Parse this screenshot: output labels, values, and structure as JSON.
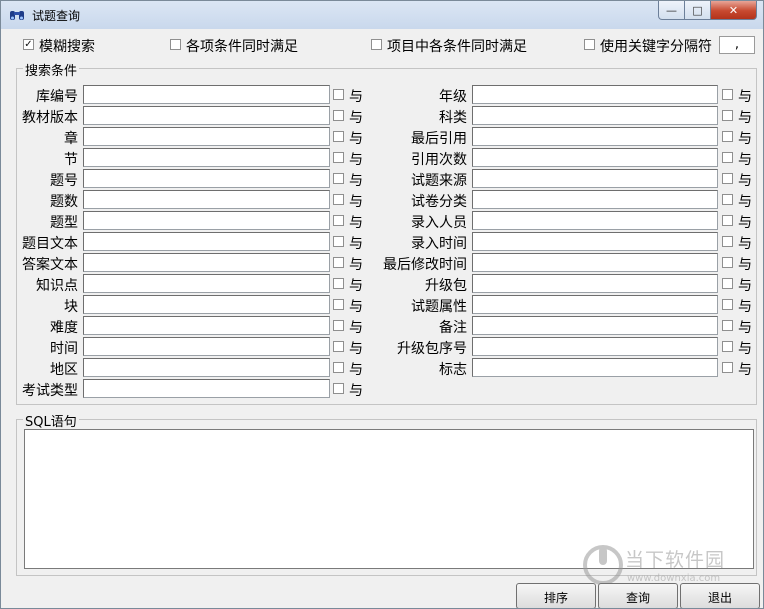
{
  "window": {
    "title": "试题查询",
    "icon": "binoculars-icon",
    "controls": {
      "minimize": "—",
      "maximize": "□",
      "close": "✕"
    }
  },
  "options": {
    "fuzzy_search": {
      "label": "模糊搜索",
      "checked": true
    },
    "all_conditions": {
      "label": "各项条件同时满足",
      "checked": false
    },
    "item_conditions": {
      "label": "项目中各条件同时满足",
      "checked": false
    },
    "keyword_separator": {
      "label": "使用关键字分隔符",
      "checked": false,
      "value": ","
    }
  },
  "search_group": {
    "legend": "搜索条件",
    "conjunction_label": "与",
    "left_fields": [
      "库编号",
      "教材版本",
      "章",
      "节",
      "题号",
      "题数",
      "题型",
      "题目文本",
      "答案文本",
      "知识点",
      "块",
      "难度",
      "时间",
      "地区",
      "考试类型"
    ],
    "right_fields": [
      "年级",
      "科类",
      "最后引用",
      "引用次数",
      "试题来源",
      "试卷分类",
      "录入人员",
      "录入时间",
      "最后修改时间",
      "升级包",
      "试题属性",
      "备注",
      "升级包序号",
      "标志"
    ]
  },
  "sql_group": {
    "legend": "SQL语句",
    "value": ""
  },
  "buttons": {
    "sort": "排序",
    "query": "查询",
    "exit": "退出"
  },
  "watermark": {
    "text": "当下软件园",
    "url": "www.downxia.com"
  }
}
